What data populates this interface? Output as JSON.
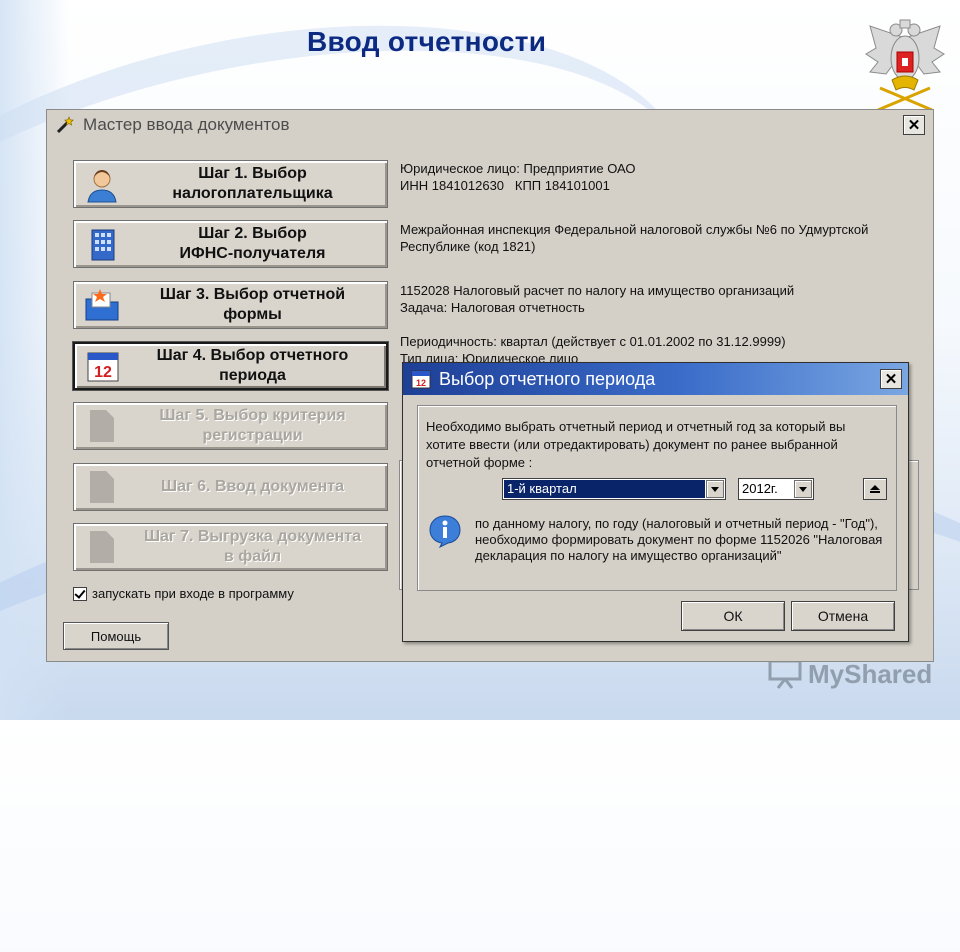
{
  "slide": {
    "title": "Ввод отчетности",
    "watermark": "MyShared"
  },
  "window": {
    "title": "Мастер ввода документов",
    "close_glyph": "✕",
    "steps": [
      {
        "label": "Шаг 1. Выбор\nналогоплательщика",
        "icon": "person-icon",
        "state": "enabled"
      },
      {
        "label": "Шаг 2. Выбор\nИФНС-получателя",
        "icon": "building-icon",
        "state": "enabled"
      },
      {
        "label": "Шаг 3. Выбор отчетной\nформы",
        "icon": "folder-form-icon",
        "state": "enabled"
      },
      {
        "label": "Шаг 4. Выбор отчетного\nпериода",
        "icon": "calendar-icon",
        "state": "active"
      },
      {
        "label": "Шаг 5. Выбор критерия\nрегистрации",
        "icon": "document-icon",
        "state": "disabled"
      },
      {
        "label": "Шаг 6. Ввод документа",
        "icon": "document-icon",
        "state": "disabled"
      },
      {
        "label": "Шаг 7. Выгрузка документа\nв файл",
        "icon": "document-icon",
        "state": "disabled"
      }
    ],
    "info": {
      "taxpayer": "Юридическое лицо: Предприятие ОАО\nИНН 1841012630   КПП 184101001",
      "inspection": "Межрайонная инспекция Федеральной налоговой службы №6 по Удмуртской\nРеспублике (код 1821)",
      "form": "1152028 Налоговый расчет по налогу на имущество организаций\nЗадача: Налоговая отчетность",
      "period": "Периодичность: квартал (действует с 01.01.2002 по 31.12.9999)\nТип лица: Юридическое лицо"
    },
    "autostart_checkbox": {
      "label": "запускать при входе в программу",
      "checked": true
    },
    "help_button": "Помощь"
  },
  "dialog": {
    "title": "Выбор отчетного периода",
    "close_glyph": "✕",
    "calendar_number": "12",
    "prompt": "Необходимо выбрать отчетный период и отчетный год за который вы хотите ввести (или отредактировать) документ по ранее выбранной отчетной форме :",
    "quarter_select": {
      "value": "1-й квартал"
    },
    "year_select": {
      "value": "2012г."
    },
    "note": "по данному налогу, по году (налоговый и отчетный период - \"Год\"), необходимо формировать документ по форме 1152026 \"Налоговая декларация по налогу на имущество организаций\"",
    "ok_button": "ОК",
    "cancel_button": "Отмена"
  },
  "colors": {
    "title_text": "#0c2a82",
    "dialog_title_start": "#1e3f96",
    "dialog_title_end": "#7aa6e2",
    "window_bg": "#d4d0c8",
    "selection_bg": "#0a246a"
  }
}
